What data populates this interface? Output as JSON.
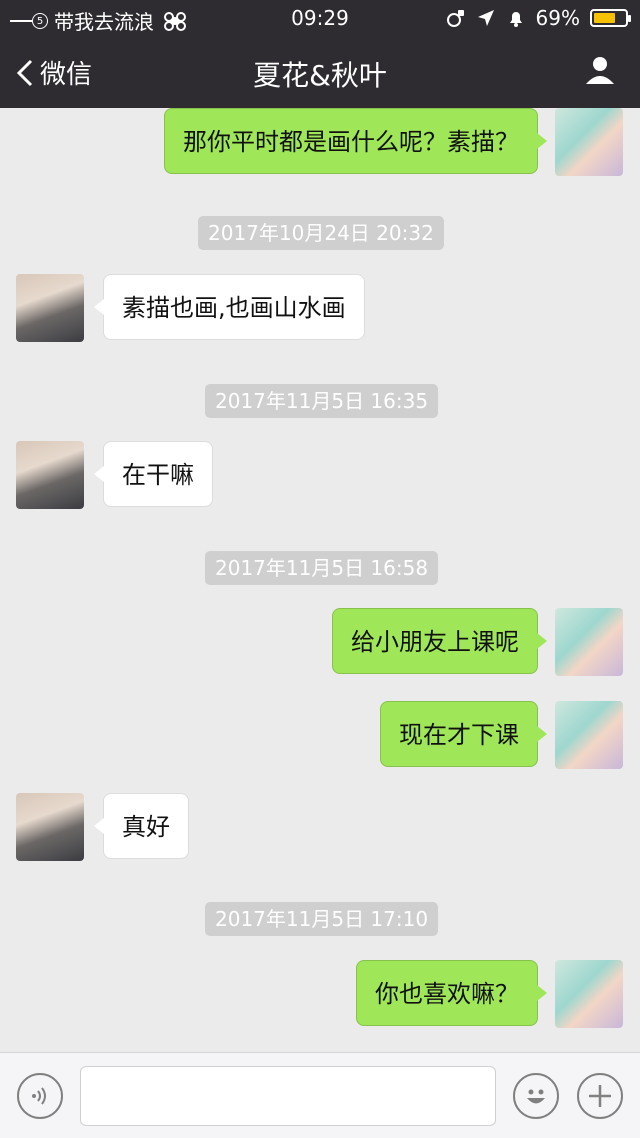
{
  "status_bar": {
    "carrier": "带我去流浪",
    "signal_badge": "5",
    "time": "09:29",
    "battery_text": "69%",
    "battery_level": 0.69,
    "battery_color": "#f6c200"
  },
  "nav": {
    "back_label": "微信",
    "title": "夏花&秋叶"
  },
  "messages": [
    {
      "side": "right",
      "text": "那你平时都是画什么呢？素描？"
    },
    {
      "timestamp": "2017年10月24日 20:32"
    },
    {
      "side": "left",
      "text": "素描也画,也画山水画"
    },
    {
      "timestamp": "2017年11月5日 16:35"
    },
    {
      "side": "left",
      "text": "在干嘛"
    },
    {
      "timestamp": "2017年11月5日 16:58"
    },
    {
      "side": "right",
      "text": "给小朋友上课呢"
    },
    {
      "side": "right",
      "text": "现在才下课"
    },
    {
      "side": "left",
      "text": "真好"
    },
    {
      "timestamp": "2017年11月5日 17:10"
    },
    {
      "side": "right",
      "text": "你也喜欢嘛？"
    }
  ],
  "input_bar": {
    "voice_icon": "voice-icon",
    "emoji_icon": "emoji-icon",
    "plus_icon": "plus-icon",
    "text_value": ""
  },
  "colors": {
    "bar": "#2e2c31",
    "sent_bubble": "#9fe658",
    "received_bubble": "#ffffff",
    "background": "#ebebeb"
  }
}
